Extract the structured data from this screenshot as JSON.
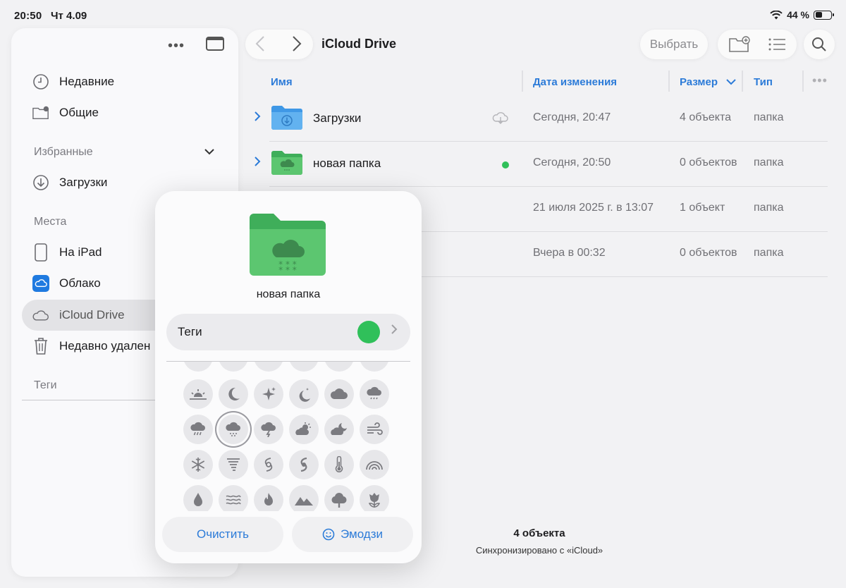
{
  "status_bar": {
    "time": "20:50",
    "date": "Чт 4.09",
    "battery": "44 %",
    "battery_level": 0.44
  },
  "sidebar": {
    "more_icon": "ellipsis-icon",
    "items_top": [
      {
        "label": "Недавние",
        "icon": "clock-icon"
      },
      {
        "label": "Общие",
        "icon": "shared-folder-icon"
      }
    ],
    "favorites": {
      "title": "Избранные",
      "items": [
        {
          "label": "Загрузки",
          "icon": "download-circle-icon"
        }
      ]
    },
    "locations": {
      "title": "Места",
      "items": [
        {
          "label": "На iPad",
          "icon": "ipad-icon"
        },
        {
          "label": "Облако",
          "icon": "cloud-app-icon"
        },
        {
          "label": "iCloud Drive",
          "icon": "icloud-icon",
          "selected": true
        },
        {
          "label": "Недавно удален",
          "icon": "trash-icon"
        }
      ]
    },
    "tags": {
      "title": "Теги"
    }
  },
  "toolbar": {
    "title": "iCloud Drive",
    "select_label": "Выбрать"
  },
  "table": {
    "headers": {
      "name": "Имя",
      "date": "Дата изменения",
      "size": "Размер",
      "kind": "Тип"
    },
    "rows": [
      {
        "name": "Загрузки",
        "date": "Сегодня, 20:47",
        "size": "4 объекта",
        "kind": "папка"
      },
      {
        "name": "новая папка",
        "date": "Сегодня, 20:50",
        "size": "0 объектов",
        "kind": "папка"
      },
      {
        "name": "",
        "date": "21 июля 2025 г. в 13:07",
        "size": "1 объект",
        "kind": "папка"
      },
      {
        "name": "",
        "date": "Вчера в 00:32",
        "size": "0 объектов",
        "kind": "папка"
      }
    ]
  },
  "footer": {
    "count": "4 объекта",
    "sync": "Синхронизировано с «iCloud»"
  },
  "popover": {
    "folder_name": "новая папка",
    "tags_label": "Теги",
    "tag_color": "#30c05a",
    "clear_label": "Очистить",
    "emoji_label": "Эмодзи",
    "icons_row1": [
      "sunset-icon",
      "moon-icon",
      "sparkles-icon",
      "moon-stars-icon",
      "cloud-icon",
      "cloud-drizzle-icon"
    ],
    "icons_row2": [
      "cloud-rain-icon",
      "cloud-snow-icon",
      "cloud-bolt-icon",
      "cloud-sun-icon",
      "cloud-moon-icon",
      "wind-icon"
    ],
    "icons_row3": [
      "snowflake-icon",
      "tornado-icon",
      "hurricane-icon",
      "tropical-storm-icon",
      "thermometer-icon",
      "rainbow-icon"
    ],
    "icons_row4": [
      "drop-icon",
      "water-waves-icon",
      "flame-icon",
      "mountains-icon",
      "tree-icon",
      "flower-icon"
    ]
  }
}
